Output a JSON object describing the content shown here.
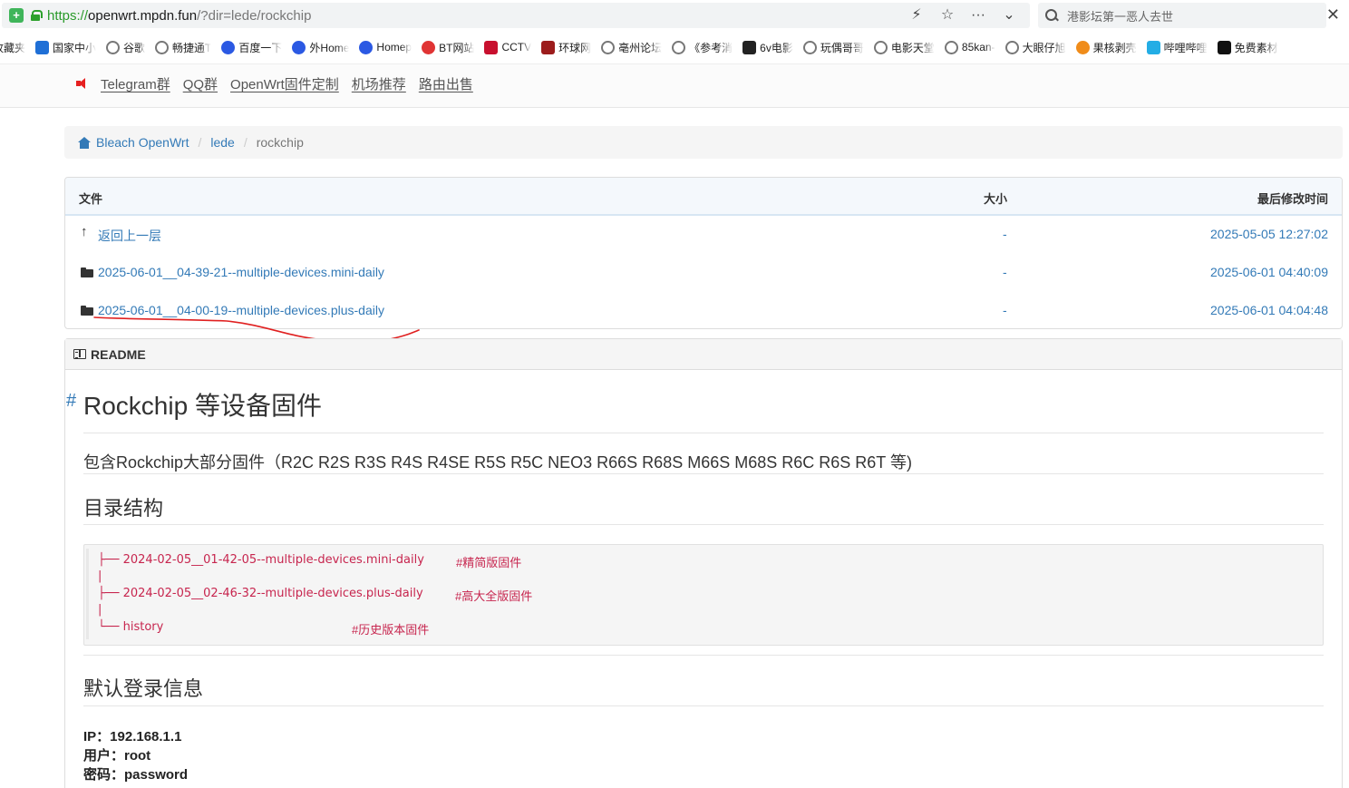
{
  "browser": {
    "url_scheme": "https://",
    "url_host": "openwrt.mpdn.fun",
    "url_path": "/?dir=lede/rockchip",
    "search_text": "港影坛第一恶人去世",
    "action_icons": [
      "lightning-icon",
      "star-icon",
      "more-icon",
      "chevron-down-icon"
    ]
  },
  "bookmarks": [
    {
      "label": "收藏夹",
      "color": "#ffffff",
      "icon": "none-icon"
    },
    {
      "label": "国家中小",
      "color": "#1f6fd6",
      "icon": "edu-icon"
    },
    {
      "label": "谷歌",
      "color": "",
      "icon": "globe-icon"
    },
    {
      "label": "畅捷通T",
      "color": "",
      "icon": "globe-icon"
    },
    {
      "label": "百度一下",
      "color": "#2b59e3",
      "icon": "baidu-icon"
    },
    {
      "label": "外Home",
      "color": "#2b59e3",
      "icon": "baidu-icon"
    },
    {
      "label": "Homep",
      "color": "#2b59e3",
      "icon": "baidu-icon"
    },
    {
      "label": "BT网站",
      "color": "#e03434",
      "icon": "bt-icon"
    },
    {
      "label": "CCTV",
      "color": "#c8102e",
      "icon": "cctv-icon"
    },
    {
      "label": "环球网",
      "color": "#9c1c1c",
      "icon": "huanqiu-icon"
    },
    {
      "label": "亳州论坛",
      "color": "",
      "icon": "globe-icon"
    },
    {
      "label": "《参考消",
      "color": "",
      "icon": "globe-icon"
    },
    {
      "label": "6v电影",
      "color": "#222222",
      "icon": "6v-icon"
    },
    {
      "label": "玩偶哥哥",
      "color": "",
      "icon": "globe-icon"
    },
    {
      "label": "电影天堂",
      "color": "",
      "icon": "globe-icon"
    },
    {
      "label": "85kan-",
      "color": "",
      "icon": "globe-icon"
    },
    {
      "label": "大眼仔旭",
      "color": "",
      "icon": "globe-icon"
    },
    {
      "label": "果核剥壳",
      "color": "#f08c1a",
      "icon": "guohe-icon"
    },
    {
      "label": "哔哩哔哩",
      "color": "#23ade5",
      "icon": "bilibili-icon"
    },
    {
      "label": "免费素材",
      "color": "#111111",
      "icon": "sucai-icon"
    }
  ],
  "site_nav": {
    "links": [
      "Telegram群",
      "QQ群",
      "OpenWrt固件定制",
      "机场推荐",
      "路由出售"
    ]
  },
  "breadcrumb": {
    "home": "Bleach OpenWrt",
    "level1": "lede",
    "current": "rockchip"
  },
  "table": {
    "headers": {
      "name": "文件",
      "size": "大小",
      "date": "最后修改时间"
    },
    "rows": [
      {
        "icon": "up-arrow-icon",
        "name": "返回上一层",
        "size": "-",
        "date": "2025-05-05 12:27:02"
      },
      {
        "icon": "folder-icon",
        "name": "2025-06-01__04-39-21--multiple-devices.mini-daily",
        "size": "-",
        "date": "2025-06-01 04:40:09"
      },
      {
        "icon": "folder-icon",
        "name": "2025-06-01__04-00-19--multiple-devices.plus-daily",
        "size": "-",
        "date": "2025-06-01 04:04:48"
      }
    ]
  },
  "readme": {
    "label": "README",
    "anchor": "#",
    "title": "Rockchip 等设备固件",
    "description": "包含Rockchip大部分固件（R2C R2S R3S R4S R4SE R5S R5C NEO3 R66S R68S M66S M68S R6C R6S R6T 等)",
    "dir_heading": "目录结构",
    "code_lines": [
      {
        "text": "├── 2024-02-05__01-42-05--multiple-devices.mini-daily",
        "comment": "#精简版固件"
      },
      {
        "text": "|",
        "comment": ""
      },
      {
        "text": "├── 2024-02-05__02-46-32--multiple-devices.plus-daily",
        "comment": "#高大全版固件"
      },
      {
        "text": "|",
        "comment": ""
      },
      {
        "text": "└── history",
        "comment": "#历史版本固件"
      }
    ],
    "login_heading": "默认登录信息",
    "login": [
      "IP：192.168.1.1",
      "用户：root",
      "密码：password"
    ]
  },
  "colors": {
    "link": "#337ab7",
    "code": "#c7254e",
    "annotation": "#e02020"
  }
}
